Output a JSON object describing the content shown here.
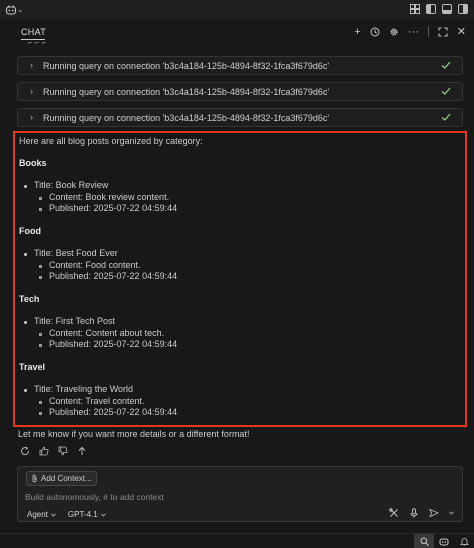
{
  "header": {
    "tab_label": "CHAT"
  },
  "tool_runs": [
    {
      "text": "Running query on connection 'b3c4a184-125b-4894-8f32-1fca3f679d6c'",
      "status_color": "#89d185"
    },
    {
      "text": "Running query on connection 'b3c4a184-125b-4894-8f32-1fca3f679d6c'",
      "status_color": "#89d185"
    },
    {
      "text": "Running query on connection 'b3c4a184-125b-4894-8f32-1fca3f679d6c'",
      "status_color": "#89d185"
    }
  ],
  "response": {
    "intro": "Here are all blog posts organized by category:",
    "categories": [
      {
        "name": "Books",
        "title": "Title: Book Review",
        "content": "Content: Book review content.",
        "published": "Published: 2025-07-22 04:59:44"
      },
      {
        "name": "Food",
        "title": "Title: Best Food Ever",
        "content": "Content: Food content.",
        "published": "Published: 2025-07-22 04:59:44"
      },
      {
        "name": "Tech",
        "title": "Title: First Tech Post",
        "content": "Content: Content about tech.",
        "published": "Published: 2025-07-22 04:59:44"
      },
      {
        "name": "Travel",
        "title": "Title: Traveling the World",
        "content": "Content: Travel content.",
        "published": "Published: 2025-07-22 04:59:44"
      }
    ],
    "highlight_color": "#e03a1e"
  },
  "followup": "Let me know if you want more details or a different format!",
  "input": {
    "add_context_label": "Add Context...",
    "placeholder": "Build autonomously, # to add context",
    "mode": "Agent",
    "model": "GPT-4.1"
  }
}
